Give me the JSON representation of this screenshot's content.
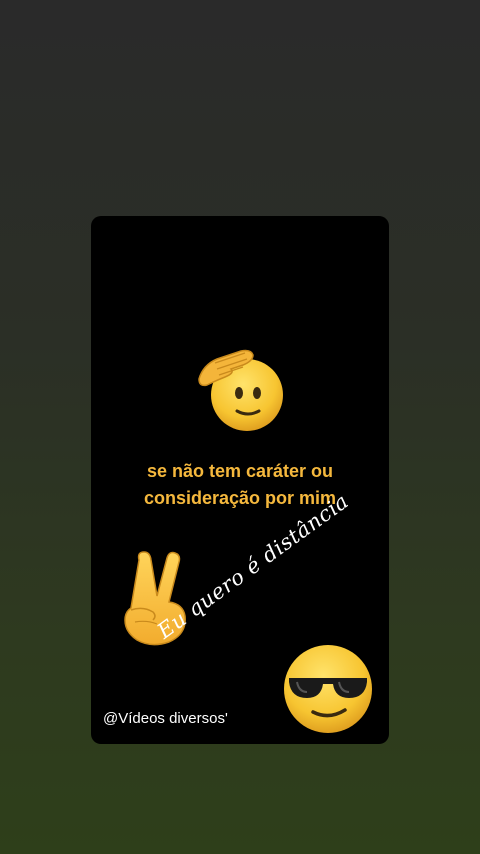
{
  "caption": {
    "line1": "se não tem caráter ou",
    "line2": "consideração por mim"
  },
  "script_text": "Eu quero é distância",
  "watermark": "@Vídeos diversos'",
  "icons": {
    "top": "saluting-face-icon",
    "left": "victory-hand-icon",
    "right": "sunglasses-face-icon"
  },
  "colors": {
    "background_top": "#2a2a2a",
    "background_bottom": "#2e3f1a",
    "card": "#000000",
    "caption": "#f5b83d",
    "emoji_yellow": "#f7c531"
  }
}
